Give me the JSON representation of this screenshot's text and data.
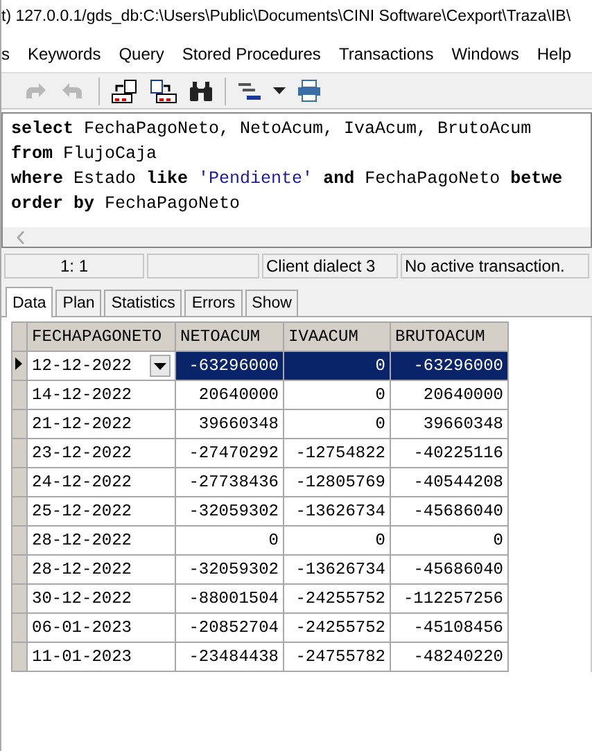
{
  "window": {
    "title": "t) 127.0.0.1/gds_db:C:\\Users\\Public\\Documents\\CINI Software\\Cexport\\Traza\\IB\\"
  },
  "menu": [
    "s",
    "Keywords",
    "Query",
    "Stored Procedures",
    "Transactions",
    "Windows",
    "Help"
  ],
  "editor": {
    "lines": [
      [
        {
          "kind": "keyword",
          "text": "select"
        },
        {
          "kind": "plain",
          "text": " FechaPagoNeto, NetoAcum, IvaAcum, BrutoAcum"
        }
      ],
      [
        {
          "kind": "keyword",
          "text": "from"
        },
        {
          "kind": "plain",
          "text": " FlujoCaja"
        }
      ],
      [
        {
          "kind": "keyword",
          "text": "where"
        },
        {
          "kind": "plain",
          "text": " Estado "
        },
        {
          "kind": "keyword",
          "text": "like "
        },
        {
          "kind": "string",
          "text": "'Pendiente'"
        },
        {
          "kind": "keyword",
          "text": " and"
        },
        {
          "kind": "plain",
          "text": " FechaPagoNeto "
        },
        {
          "kind": "keyword",
          "text": "betwe"
        }
      ],
      [
        {
          "kind": "keyword",
          "text": "order by"
        },
        {
          "kind": "plain",
          "text": " FechaPagoNeto"
        }
      ]
    ]
  },
  "status_bar": [
    "1: 1",
    "Client dialect 3",
    "No active transaction."
  ],
  "tabs": [
    {
      "label": "Data",
      "selected": true
    },
    {
      "label": "Plan",
      "selected": false
    },
    {
      "label": "Statistics",
      "selected": false
    },
    {
      "label": "Errors",
      "selected": false
    },
    {
      "label": "Show",
      "selected": false
    }
  ],
  "table": {
    "columns": [
      "FECHAPAGONETO",
      "NETOACUM",
      "IVAACUM",
      "BRUTOACUM"
    ],
    "rows": [
      {
        "selected": true,
        "cells": [
          "12-12-2022",
          "-63296000",
          "0",
          "-63296000"
        ]
      },
      {
        "selected": false,
        "cells": [
          "14-12-2022",
          "20640000",
          "0",
          "20640000"
        ]
      },
      {
        "selected": false,
        "cells": [
          "21-12-2022",
          "39660348",
          "0",
          "39660348"
        ]
      },
      {
        "selected": false,
        "cells": [
          "23-12-2022",
          "-27470292",
          "-12754822",
          "-40225116"
        ]
      },
      {
        "selected": false,
        "cells": [
          "24-12-2022",
          "-27738436",
          "-12805769",
          "-40544208"
        ]
      },
      {
        "selected": false,
        "cells": [
          "25-12-2022",
          "-32059302",
          "-13626734",
          "-45686040"
        ]
      },
      {
        "selected": false,
        "cells": [
          "28-12-2022",
          "0",
          "0",
          "0"
        ]
      },
      {
        "selected": false,
        "cells": [
          "28-12-2022",
          "-32059302",
          "-13626734",
          "-45686040"
        ]
      },
      {
        "selected": false,
        "cells": [
          "30-12-2022",
          "-88001504",
          "-24255752",
          "-112257256"
        ]
      },
      {
        "selected": false,
        "cells": [
          "06-01-2023",
          "-20852704",
          "-24255752",
          "-45108456"
        ]
      },
      {
        "selected": false,
        "cells": [
          "11-01-2023",
          "-23484438",
          "-24755782",
          "-48240220"
        ]
      }
    ]
  }
}
